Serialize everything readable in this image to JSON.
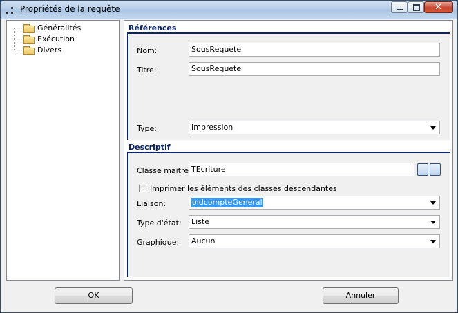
{
  "window": {
    "title": "Propriétés de la requête",
    "controls": {
      "minimize_icon": "minimize-icon",
      "maximize_icon": "maximize-icon",
      "close_icon": "close-icon",
      "close_glyph": "✕"
    }
  },
  "tree": {
    "items": [
      {
        "label": "Généralités",
        "icon": "folder-icon"
      },
      {
        "label": "Exécution",
        "icon": "folder-icon"
      },
      {
        "label": "Divers",
        "icon": "folder-icon"
      }
    ]
  },
  "references": {
    "title": "Références",
    "nom": {
      "label": "Nom:",
      "value": "SousRequete"
    },
    "titre": {
      "label": "Titre:",
      "value": "SousRequete"
    },
    "type": {
      "label": "Type:",
      "value": "Impression"
    }
  },
  "descriptif": {
    "title": "Descriptif",
    "classe_maitre": {
      "label": "Classe maitre:",
      "value": "TEcriture"
    },
    "imprimer_checkbox": {
      "label": "Imprimer les éléments des classes descendantes",
      "checked": false
    },
    "liaison": {
      "label": "Liaison:",
      "value": "oidcompteGeneral"
    },
    "type_etat": {
      "label": "Type d'état:",
      "value": "Liste"
    },
    "graphique": {
      "label": "Graphique:",
      "value": "Aucun"
    }
  },
  "buttons": {
    "ok": {
      "mnemonic": "O",
      "rest": "K"
    },
    "annuler": {
      "mnemonic": "A",
      "rest": "nnuler"
    }
  },
  "colors": {
    "section_title": "#0a246a",
    "selection": "#3399ff"
  }
}
